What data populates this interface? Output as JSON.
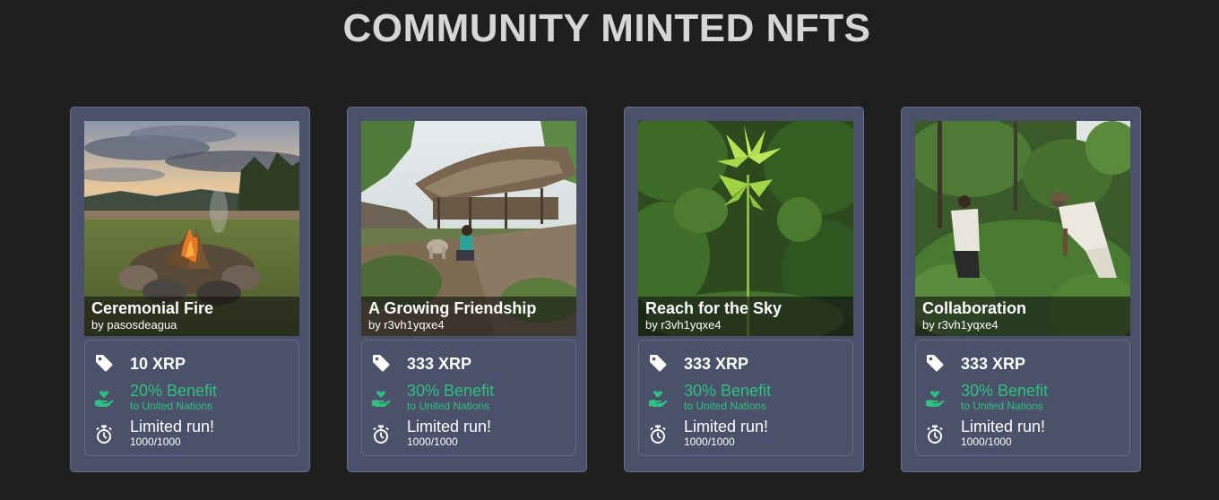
{
  "page": {
    "title": "COMMUNITY MINTED NFTS",
    "background": "#1f1f1f"
  },
  "colors": {
    "card_bg": "#4b506b",
    "benefit_green": "#2ec27e",
    "text_white": "#ffffff",
    "title_gray": "#d6d6d6"
  },
  "icons": {
    "price": "price-tag-icon",
    "benefit": "hand-heart-icon",
    "limited": "stopwatch-icon"
  },
  "cards": [
    {
      "name": "Ceremonial Fire",
      "author": "by pasosdeagua",
      "price": "10 XRP",
      "benefit": "20% Benefit",
      "benefit_to": "to United Nations",
      "limited": "Limited run!",
      "count": "1000/1000",
      "image": "campfire-landscape-photo"
    },
    {
      "name": "A Growing Friendship",
      "author": "by r3vh1yqxe4",
      "price": "333 XRP",
      "benefit": "30% Benefit",
      "benefit_to": "to United Nations",
      "limited": "Limited run!",
      "count": "1000/1000",
      "image": "thatched-hut-with-person-and-dog-photo"
    },
    {
      "name": "Reach for the Sky",
      "author": "by r3vh1yqxe4",
      "price": "333 XRP",
      "benefit": "30% Benefit",
      "benefit_to": "to United Nations",
      "limited": "Limited run!",
      "count": "1000/1000",
      "image": "young-tree-in-jungle-photo"
    },
    {
      "name": "Collaboration",
      "author": "by r3vh1yqxe4",
      "price": "333 XRP",
      "benefit": "30% Benefit",
      "benefit_to": "to United Nations",
      "limited": "Limited run!",
      "count": "1000/1000",
      "image": "people-planting-in-forest-photo"
    }
  ]
}
